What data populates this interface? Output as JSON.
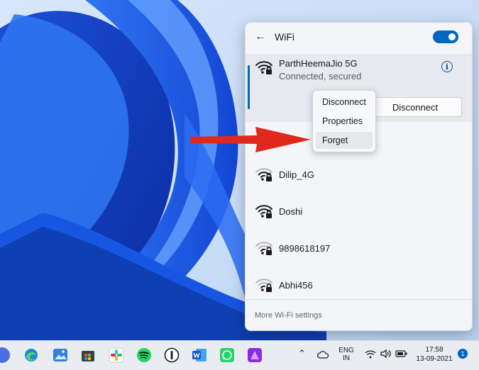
{
  "panel": {
    "title": "WiFi",
    "toggle_on": true,
    "connected": {
      "name": "ParthHeemaJio 5G",
      "status": "Connected, secured",
      "disconnect_label": "Disconnect"
    },
    "networks": [
      {
        "name": "Dilip_4G"
      },
      {
        "name": "Doshi"
      },
      {
        "name": "9898618197"
      },
      {
        "name": "Abhi456"
      }
    ],
    "more_settings": "More Wi-Fi settings"
  },
  "context_menu": {
    "items": [
      {
        "label": "Disconnect"
      },
      {
        "label": "Properties"
      },
      {
        "label": "Forget",
        "highlighted": true
      }
    ]
  },
  "taskbar": {
    "language": "ENG",
    "region": "IN",
    "time": "17:58",
    "date": "13-09-2021",
    "notification_count": "1",
    "apps": [
      "zoom-icon",
      "edge-icon",
      "photos-icon",
      "store-icon",
      "slack-icon",
      "spotify-icon",
      "onepassword-icon",
      "word-icon",
      "whatsapp-icon",
      "affinity-icon"
    ]
  },
  "colors": {
    "accent": "#0067c0",
    "arrow": "#e0281c"
  }
}
